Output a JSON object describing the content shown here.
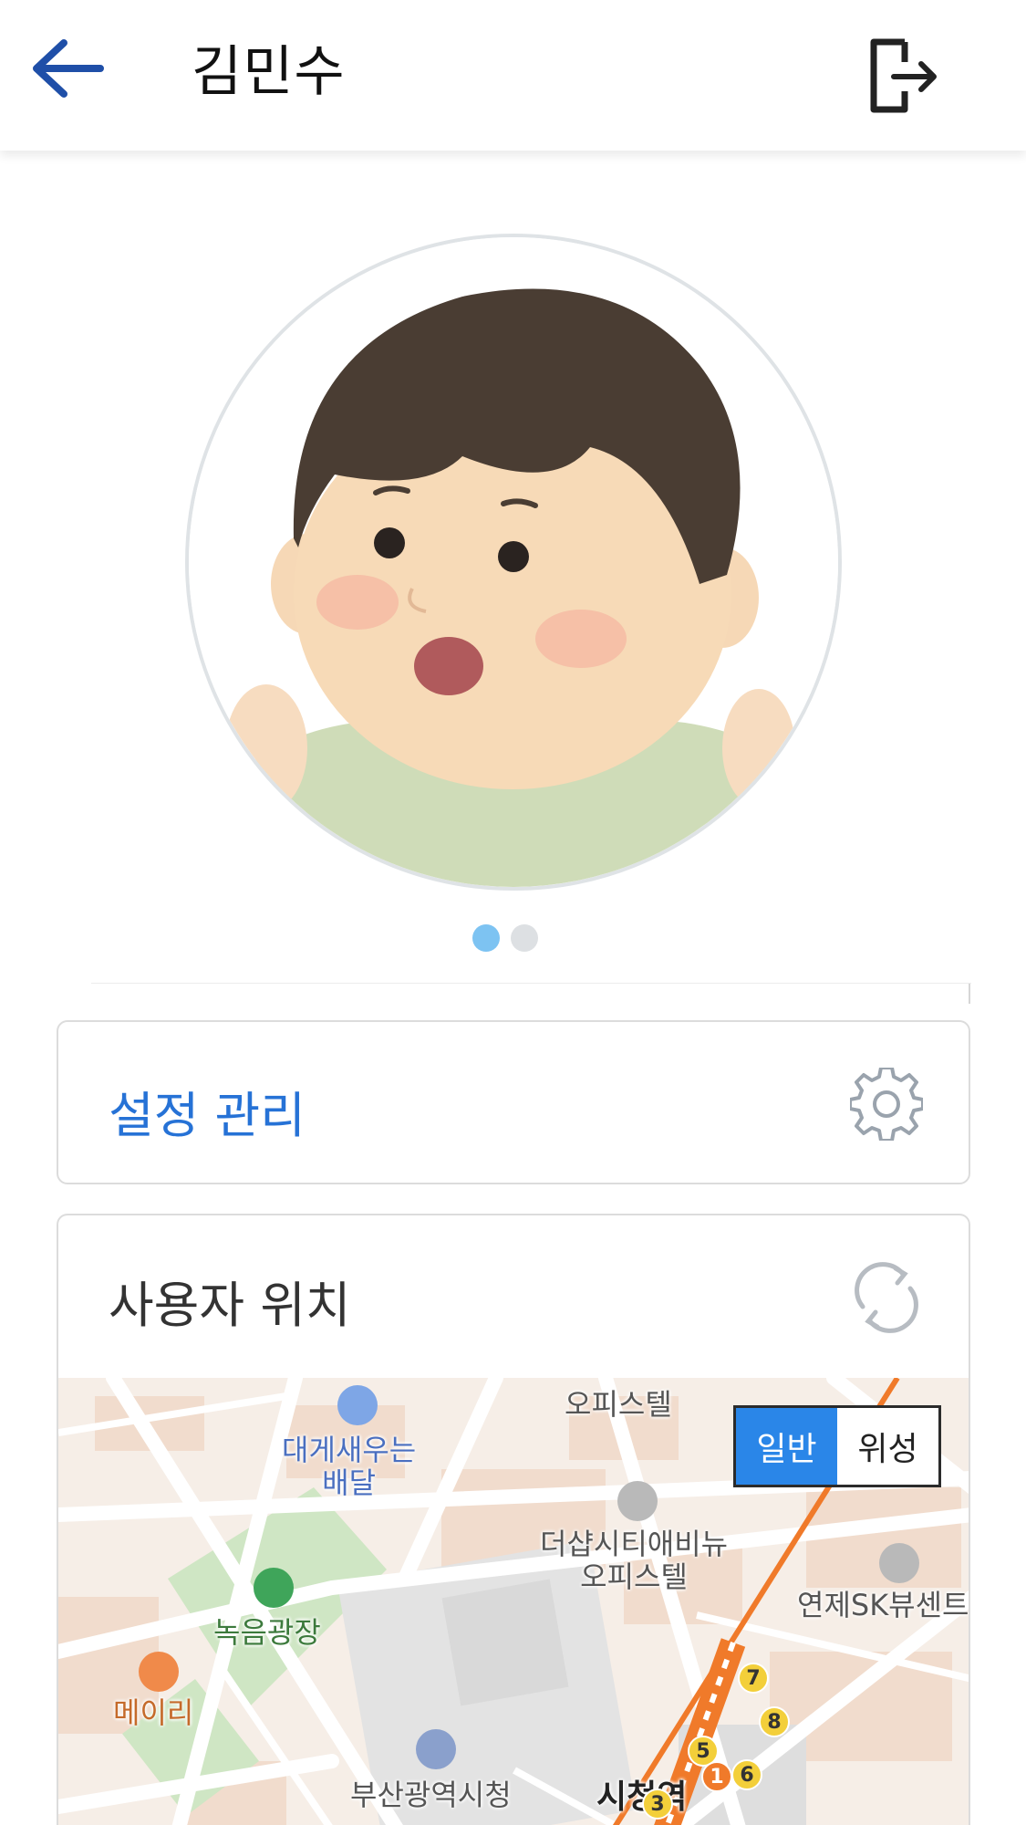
{
  "header": {
    "title": "김민수",
    "back_icon": "arrow-left-icon",
    "logout_icon": "logout-icon"
  },
  "profile": {
    "avatar": "child-avatar-illustration",
    "carousel": {
      "pages": 2,
      "active": 1
    }
  },
  "settings_card": {
    "label": "설정 관리",
    "icon": "gear-icon",
    "label_color": "#2672d6"
  },
  "location_card": {
    "label": "사용자 위치",
    "icon": "refresh-icon"
  },
  "map": {
    "toggle": {
      "normal": "일반",
      "satellite": "위성",
      "selected": "일반"
    },
    "labels": {
      "officetel_top": "오피스텔",
      "crab_delivery": "대게새우는\n배달",
      "the_sharp": "더샵시티애비뉴\n오피스텔",
      "yeonje_sk": "연제SK뷰센트",
      "green_square": "녹음광장",
      "meiri": "메이리",
      "city_hall": "부산광역시청",
      "city_hall_station": "시청역"
    },
    "exit_numbers": [
      "7",
      "8",
      "5",
      "1",
      "6",
      "3"
    ],
    "colors": {
      "accent": "#2a86e8",
      "subway": "#f07a2a",
      "park": "#cfe6c4"
    }
  }
}
